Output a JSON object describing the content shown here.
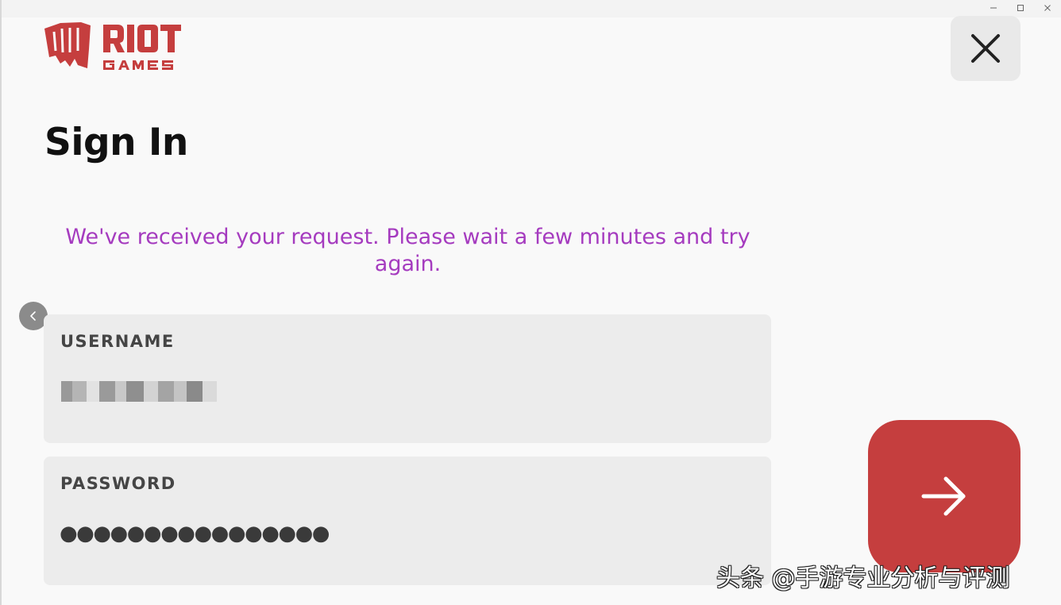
{
  "window": {
    "controls": {
      "minimize_icon": "minimize-icon",
      "maximize_icon": "maximize-icon",
      "close_icon": "close-icon"
    }
  },
  "logo": {
    "line1": "RIOT",
    "line2": "GAMES",
    "color": "#c53e3e"
  },
  "page": {
    "title": "Sign In",
    "message": "We've received your request. Please wait a few minutes and try again.",
    "message_color": "#a53bbf"
  },
  "form": {
    "username": {
      "label": "USERNAME"
    },
    "password": {
      "label": "PASSWORD",
      "masked_value": "●●●●●●●●●●●●●●●●"
    },
    "submit_icon": "arrow-right-icon",
    "submit_color": "#c53e3e"
  },
  "watermark": {
    "text": "头条 @手游专业分析与评测"
  }
}
